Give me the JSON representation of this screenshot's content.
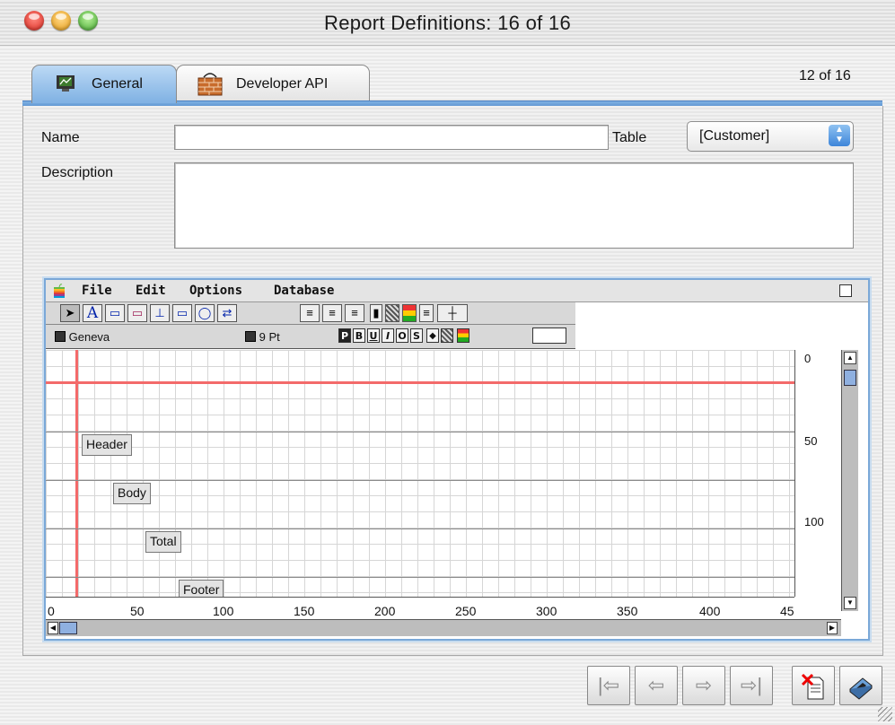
{
  "window": {
    "title": "Report Definitions: 16 of 16"
  },
  "tabs": [
    {
      "label": "General",
      "icon": "monitor-icon"
    },
    {
      "label": "Developer API",
      "icon": "brick-wall-icon"
    }
  ],
  "record_count": "12 of 16",
  "form": {
    "name_label": "Name",
    "name_value": "",
    "table_label": "Table",
    "table_value": "[Customer]",
    "description_label": "Description",
    "description_value": ""
  },
  "editor": {
    "menus": [
      "File",
      "Edit",
      "Options",
      "Database"
    ],
    "font_name": "Geneva",
    "font_size": "9 Pt",
    "style_buttons": [
      "P",
      "B",
      "U",
      "I",
      "O",
      "S"
    ],
    "bands": [
      "Header",
      "Body",
      "Total",
      "Footer"
    ],
    "v_ruler": [
      "0",
      "50",
      "100"
    ],
    "h_ruler": [
      "0",
      "50",
      "100",
      "150",
      "200",
      "250",
      "300",
      "350",
      "400",
      "45"
    ]
  },
  "nav": {
    "first": "|⇦",
    "prev": "⇦",
    "next": "⇨",
    "last": "⇨|"
  }
}
